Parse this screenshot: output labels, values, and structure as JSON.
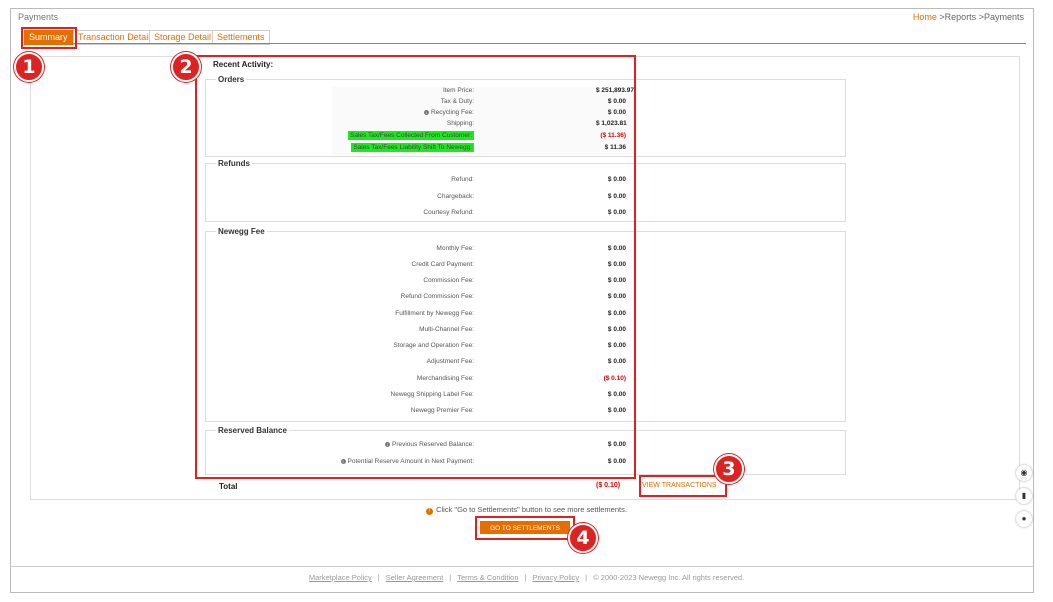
{
  "header": {
    "page_title": "Payments",
    "breadcrumb": {
      "home": "Home",
      "sep1": ">",
      "reports": "Reports",
      "sep2": ">",
      "current": "Payments"
    }
  },
  "tabs": [
    {
      "label": "Summary",
      "active": true
    },
    {
      "label": "Transaction Detail",
      "active": false
    },
    {
      "label": "Storage Detail",
      "active": false
    },
    {
      "label": "Settlements",
      "active": false
    }
  ],
  "recent_activity_title": "Recent Activity:",
  "orders": {
    "title": "Orders",
    "rows": [
      {
        "label": "Item Price:",
        "value": "$ 251,893.97"
      },
      {
        "label": "Tax & Duty:",
        "value": "$ 0.00"
      },
      {
        "label": "Recycling Fee:",
        "value": "$ 0.00"
      },
      {
        "label": "Shipping:",
        "value": "$ 1,023.81"
      },
      {
        "label": "Sales Tax/Fees Collected From Customer:",
        "value": "($ 11.36)"
      },
      {
        "label": "Sales Tax/Fees Liability Shift To Newegg:",
        "value": "$ 11.36"
      }
    ]
  },
  "refunds": {
    "title": "Refunds",
    "rows": [
      {
        "label": "Refund:",
        "value": "$ 0.00"
      },
      {
        "label": "Chargeback:",
        "value": "$ 0.00"
      },
      {
        "label": "Courtesy Refund:",
        "value": "$ 0.00"
      }
    ]
  },
  "newegg_fee": {
    "title": "Newegg Fee",
    "rows": [
      {
        "label": "Monthly Fee:",
        "value": "$ 0.00"
      },
      {
        "label": "Credit Card Payment:",
        "value": "$ 0.00"
      },
      {
        "label": "Commission Fee:",
        "value": "$ 0.00"
      },
      {
        "label": "Refund Commission Fee:",
        "value": "$ 0.00"
      },
      {
        "label": "Fulfillment by Newegg Fee:",
        "value": "$ 0.00"
      },
      {
        "label": "Multi-Channel Fee:",
        "value": "$ 0.00"
      },
      {
        "label": "Storage and Operation Fee:",
        "value": "$ 0.00"
      },
      {
        "label": "Adjustment Fee:",
        "value": "$ 0.00"
      },
      {
        "label": "Merchandising Fee:",
        "value": "($ 0.10)"
      },
      {
        "label": "Newegg Shipping Label Fee:",
        "value": "$ 0.00"
      },
      {
        "label": "Newegg Premier Fee:",
        "value": "$ 0.00"
      }
    ]
  },
  "reserved_balance": {
    "title": "Reserved Balance",
    "rows": [
      {
        "label": "Previous Reserved Balance:",
        "value": "$ 0.00"
      },
      {
        "label": "Potential Reserve Amount in Next Payment:",
        "value": "$ 0.00"
      }
    ]
  },
  "total": {
    "label": "Total",
    "value": "($ 0.10)"
  },
  "view_transactions": "VIEW TRANSACTIONS",
  "hint": "Click \"Go to Settlements\" button to see more settlements.",
  "go_settlements": "GO TO SETTLEMENTS",
  "footer": {
    "links": [
      "Marketplace Policy",
      "Seller Agreement",
      "Terms & Condition",
      "Privacy Policy"
    ],
    "separator": "|",
    "copyright": "© 2000-2023 Newegg Inc. All rights reserved."
  },
  "annotations": [
    "1",
    "2",
    "3",
    "4"
  ],
  "colors": {
    "accent": "#e46f00",
    "highlight": "#1ee81e",
    "annotation": "#d22222",
    "negative": "#dd0000"
  },
  "side_icons": [
    "eye-icon",
    "book-icon",
    "chat-icon"
  ]
}
